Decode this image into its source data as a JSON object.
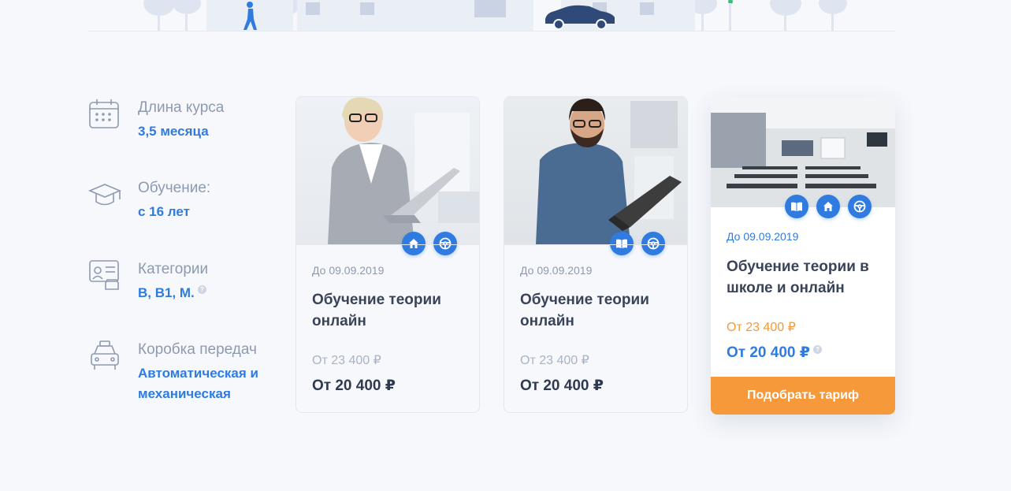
{
  "colors": {
    "accent": "#2f7be0",
    "cta": "#f6993a",
    "old_price_featured": "#f39a3a",
    "label": "#8d9ab0",
    "background": "#f6f8fc"
  },
  "features": [
    {
      "icon": "calendar-icon",
      "label": "Длина курса",
      "value": "3,5 месяца"
    },
    {
      "icon": "graduation-cap-icon",
      "label": "Обучение:",
      "value": "с 16 лет"
    },
    {
      "icon": "license-card-icon",
      "label": "Категории",
      "value": "B, B1, M.",
      "help": "?"
    },
    {
      "icon": "car-icon",
      "label": "Коробка передач",
      "value": "Автоматическая и механическая"
    }
  ],
  "cards": [
    {
      "date": "До 09.09.2019",
      "title": "Обучение теории онлайн",
      "old_price": "От 23 400 ₽",
      "new_price": "От 20 400 ₽",
      "badges": [
        "home-icon",
        "steering-wheel-icon"
      ]
    },
    {
      "date": "До 09.09.2019",
      "title": "Обучение теории онлайн",
      "old_price": "От 23 400 ₽",
      "new_price": "От 20 400 ₽",
      "badges": [
        "book-icon",
        "steering-wheel-icon"
      ]
    },
    {
      "date": "До 09.09.2019",
      "title": "Обучение теории в школе и онлайн",
      "old_price": "От 23 400 ₽",
      "new_price": "От 20 400 ₽",
      "help": "?",
      "badges": [
        "book-icon",
        "home-icon",
        "steering-wheel-icon"
      ],
      "cta": "Подобрать тариф"
    }
  ]
}
